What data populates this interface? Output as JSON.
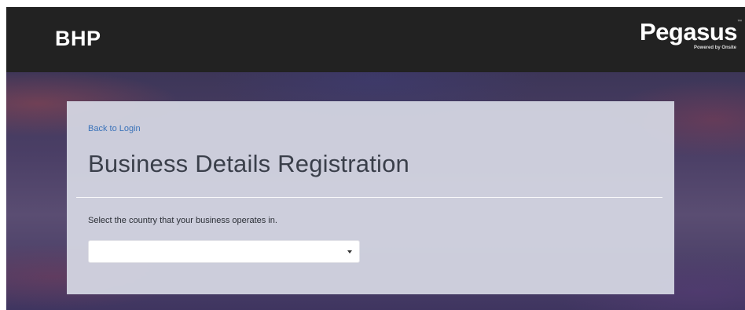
{
  "header": {
    "brand_left": "BHP",
    "brand_right": "Pegasus",
    "brand_right_tm": "™",
    "brand_right_sub": "Powered by Onsite"
  },
  "panel": {
    "back_link": "Back to Login",
    "title": "Business Details Registration",
    "instruction": "Select the country that your business operates in.",
    "country_select": {
      "value": "",
      "icon": "chevron-down-icon"
    }
  },
  "colors": {
    "topbar": "#222222",
    "link": "#3b73b9",
    "panel": "#d6d8e4",
    "title": "#3a3f4a"
  }
}
